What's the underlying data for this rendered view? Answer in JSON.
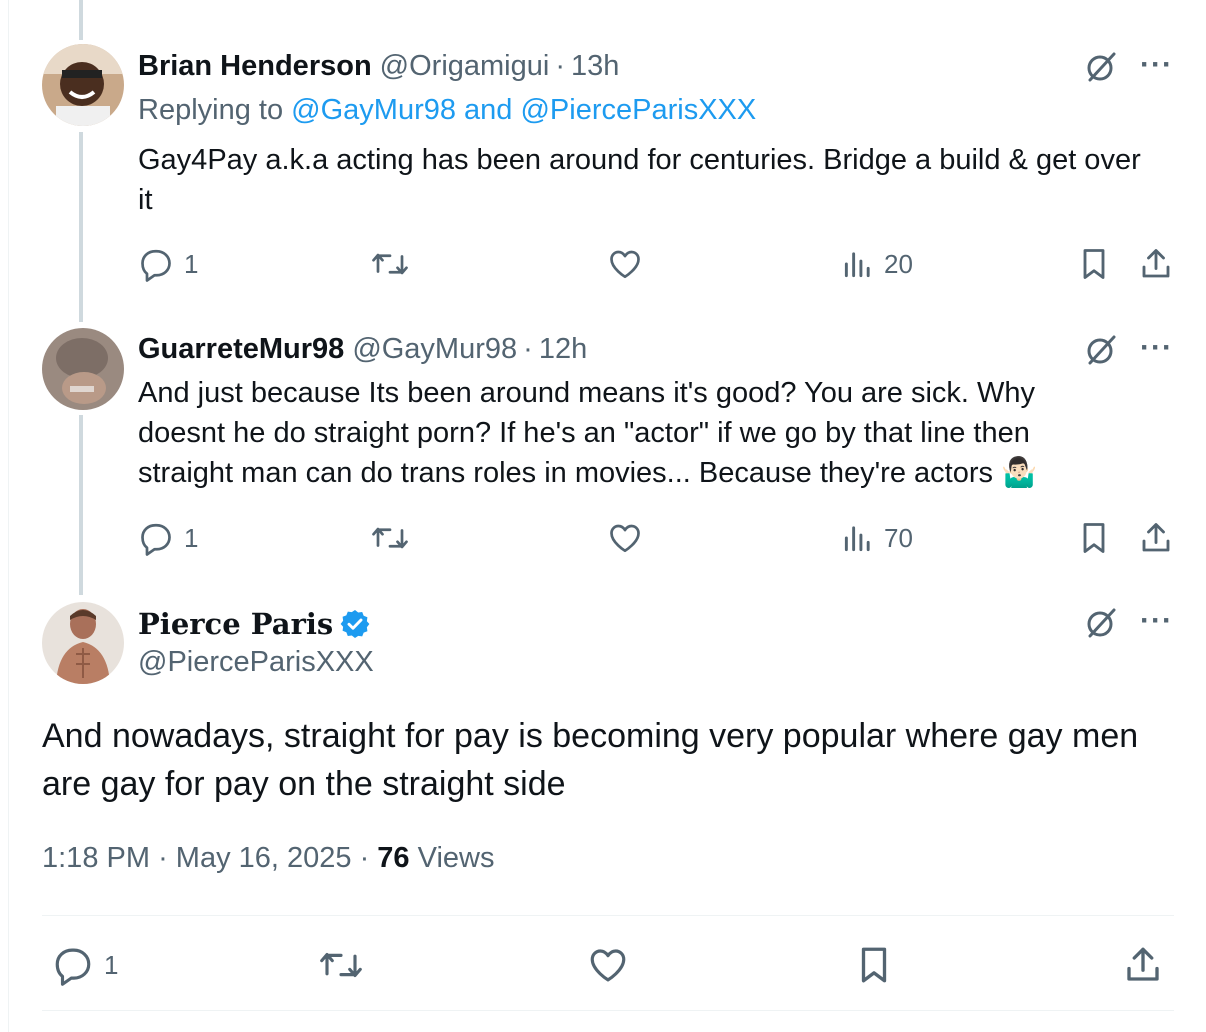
{
  "tweets": [
    {
      "name": "Brian Henderson",
      "handle": "@Origamigui",
      "time": "13h",
      "replying_prefix": "Replying to ",
      "replying_to": "@GayMur98 and @PierceParisXXX",
      "text": "Gay4Pay a.k.a acting has been around for centuries. Bridge a build & get over it",
      "replies": "1",
      "views": "20"
    },
    {
      "name": "GuarreteMur98",
      "handle": "@GayMur98",
      "time": "12h",
      "text": "And just because Its been around means it's good? You are sick. Why doesnt he do straight porn? If he's an \"actor\" if we go by that line then straight man can do trans roles in movies... Because they're actors 🤷🏻‍♂️",
      "replies": "1",
      "views": "70"
    }
  ],
  "main_tweet": {
    "name": "Pierce Paris",
    "handle": "@PierceParisXXX",
    "text": "And nowadays, straight for pay is becoming very popular where gay men are gay for pay on the straight side",
    "time": "1:18 PM",
    "date": "May 16, 2025",
    "views_count": "76",
    "views_label": "Views",
    "replies": "1"
  },
  "colors": {
    "link": "#1d9bf0",
    "muted": "#536471",
    "verified": "#1d9bf0",
    "thread_line": "#cfd9de"
  },
  "icons": [
    "reply-icon",
    "retweet-icon",
    "like-icon",
    "views-icon",
    "bookmark-icon",
    "share-icon",
    "grok-icon",
    "more-icon",
    "verified-badge-icon"
  ]
}
